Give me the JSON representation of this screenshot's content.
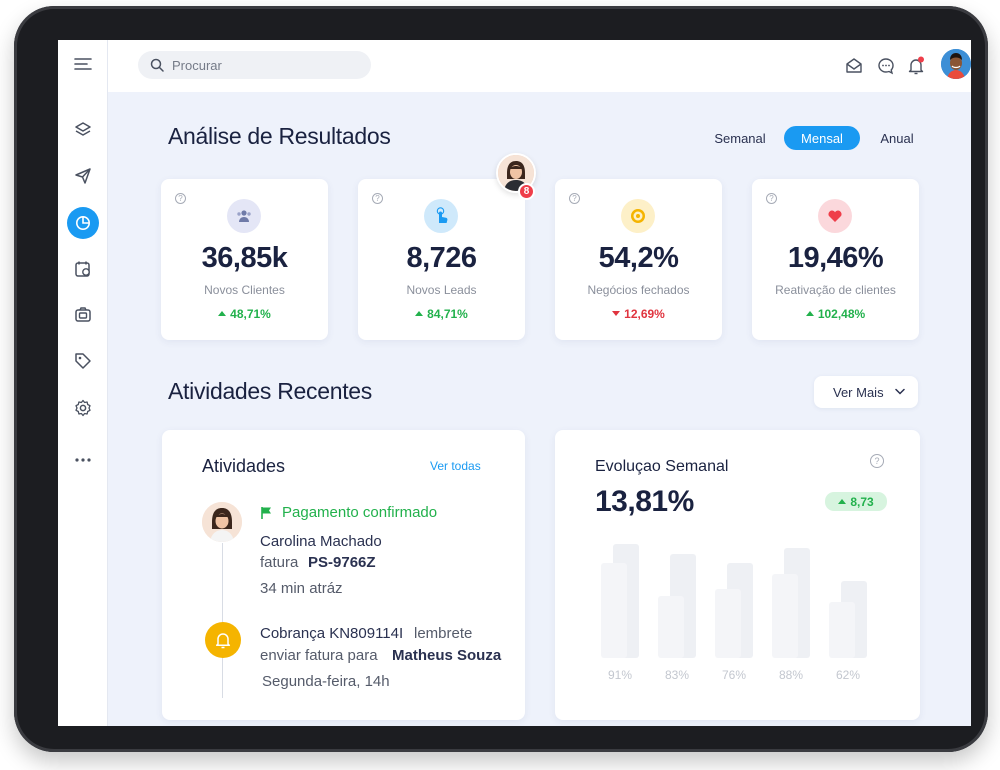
{
  "search": {
    "placeholder": "Procurar"
  },
  "header": {
    "title": "Análise de Resultados"
  },
  "periods": [
    {
      "label": "Semanal",
      "active": false
    },
    {
      "label": "Mensal",
      "active": true
    },
    {
      "label": "Anual",
      "active": false
    }
  ],
  "kpis": [
    {
      "value": "36,85k",
      "label": "Novos Clientes",
      "change": "48,71%",
      "trend": "up",
      "icon": "users-icon"
    },
    {
      "value": "8,726",
      "label": "Novos Leads",
      "change": "84,71%",
      "trend": "up",
      "icon": "touch-icon"
    },
    {
      "value": "54,2%",
      "label": "Negócios fechados",
      "change": "12,69%",
      "trend": "down",
      "icon": "target-icon"
    },
    {
      "value": "19,46%",
      "label": "Reativação de clientes",
      "change": "102,48%",
      "trend": "up",
      "icon": "heart-icon"
    }
  ],
  "notification_badge": "8",
  "recent": {
    "title": "Atividades Recentes",
    "ver_mais": "Ver Mais"
  },
  "activities": {
    "title": "Atividades",
    "link": "Ver todas",
    "items": [
      {
        "status": "Pagamento confirmado",
        "name": "Carolina Machado",
        "invoice_label": "fatura",
        "invoice_id": "PS-9766Z",
        "time": "34 min atráz"
      },
      {
        "title": "Cobrança KN809114I",
        "title_suffix": "lembrete",
        "line2": "enviar fatura para",
        "recipient": "Matheus Souza",
        "time": "Segunda-feira, 14h"
      }
    ]
  },
  "weekly": {
    "title": "Evoluçao Semanal",
    "value": "13,81%",
    "change": "8,73"
  },
  "chart_data": {
    "type": "bar",
    "categories": [
      "91%",
      "83%",
      "76%",
      "88%",
      "62%"
    ],
    "series": [
      {
        "values": [
          91,
          83,
          76,
          88,
          62
        ]
      },
      {
        "values": [
          76,
          50,
          55,
          67,
          45
        ]
      }
    ],
    "ylim": [
      0,
      100
    ]
  },
  "colors": {
    "accent": "#1a9af2",
    "up": "#22b14c",
    "down": "#e0343f"
  }
}
